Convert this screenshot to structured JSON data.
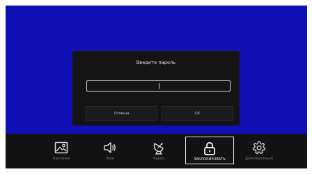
{
  "dialog": {
    "title": "Введите пароль",
    "password_value": "",
    "cancel_label": "Отмена",
    "ok_label": "OK"
  },
  "menu": {
    "items": [
      {
        "label": "Картинка",
        "icon": "picture-icon"
      },
      {
        "label": "Звук",
        "icon": "speaker-icon"
      },
      {
        "label": "Канал",
        "icon": "satellite-dish-icon"
      },
      {
        "label": "ЗАБЛОКИРОВАТЬ",
        "icon": "lock-icon",
        "active": true
      },
      {
        "label": "Дополнительно",
        "icon": "gear-icon"
      }
    ]
  },
  "colors": {
    "background": "#0f0fb5",
    "panel": "#141414",
    "menubar": "#121212"
  }
}
